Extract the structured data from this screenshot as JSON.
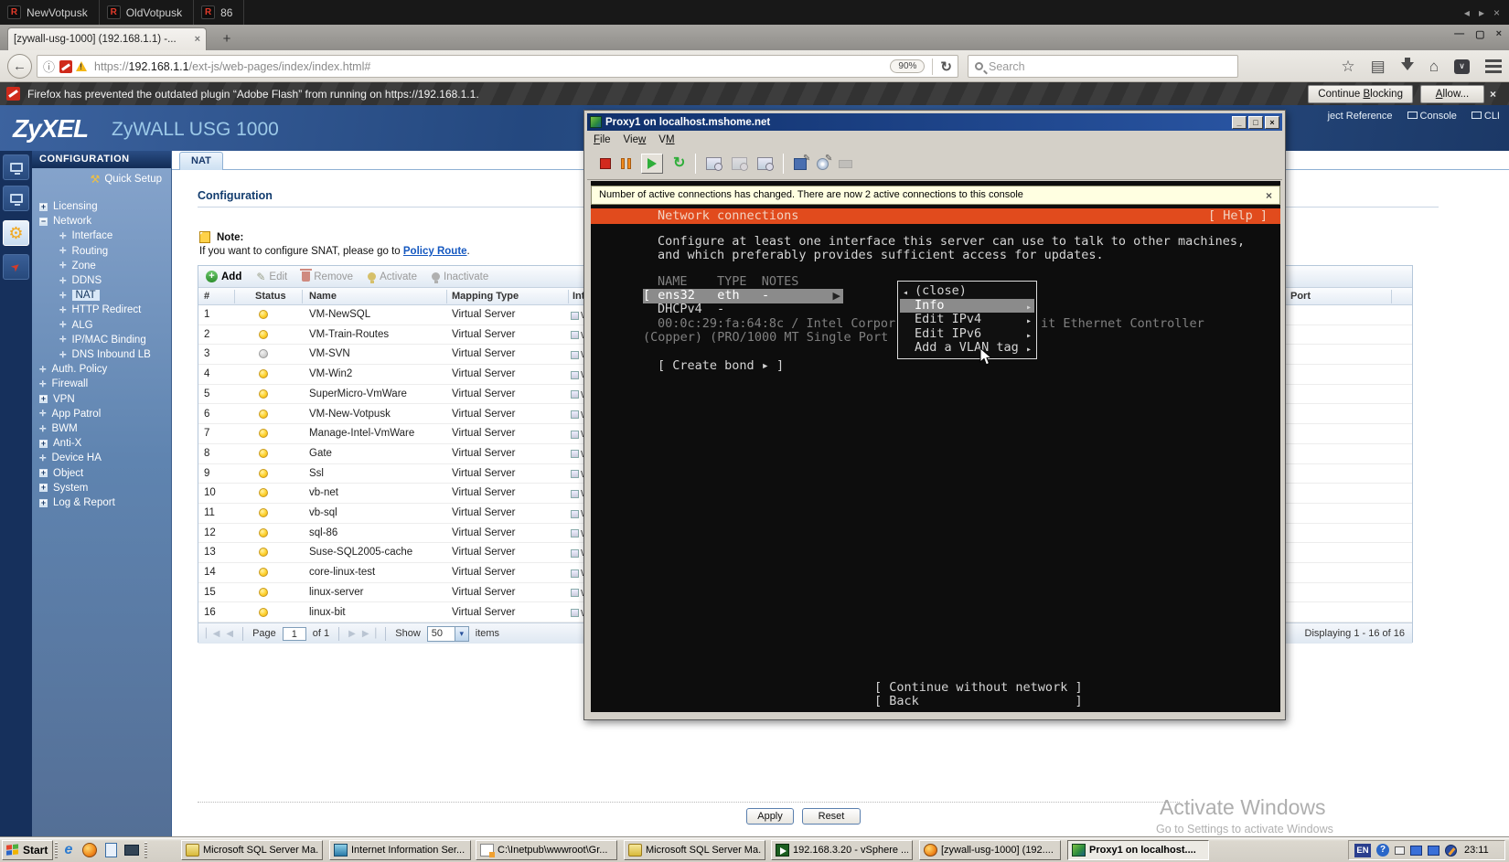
{
  "rdp_bar": {
    "tabs": [
      "NewVotpusk",
      "OldVotpusk",
      "86"
    ],
    "controls": [
      "◂",
      "▸",
      "×"
    ]
  },
  "browser": {
    "tab_title": "[zywall-usg-1000] (192.168.1.1) -...",
    "tab_close": "×",
    "new_tab": "+",
    "back": "←",
    "url_scheme": "https://",
    "url_host": "192.168.1.1",
    "url_path": "/ext-js/web-pages/index/index.html#",
    "zoom_level": "90%",
    "reload": "↻",
    "search_placeholder": "Search",
    "warning_text": "Firefox has prevented the outdated plugin “Adobe Flash” from running on https://192.168.1.1.",
    "btn_continue": "Continue Blocking",
    "btn_allow": "Allow...",
    "warn_close": "×",
    "win_min": "—",
    "win_max": "▢",
    "win_close": "×"
  },
  "zyxel": {
    "brand": "ZyXEL",
    "product": "ZyWALL USG 1000",
    "header_links": [
      "ject Reference",
      "Console",
      "CLI"
    ],
    "sidebar_title": "CONFIGURATION",
    "quick_setup": "Quick Setup",
    "nav": [
      {
        "label": "Licensing",
        "type": "plus",
        "level": 0
      },
      {
        "label": "Network",
        "type": "minus",
        "level": 0
      },
      {
        "label": "Interface",
        "type": "bullet",
        "level": 1
      },
      {
        "label": "Routing",
        "type": "bullet",
        "level": 1
      },
      {
        "label": "Zone",
        "type": "bullet",
        "level": 1
      },
      {
        "label": "DDNS",
        "type": "bullet",
        "level": 1
      },
      {
        "label": "NAT",
        "type": "bullet",
        "level": 1,
        "selected": true
      },
      {
        "label": "HTTP Redirect",
        "type": "bullet",
        "level": 1
      },
      {
        "label": "ALG",
        "type": "bullet",
        "level": 1
      },
      {
        "label": "IP/MAC Binding",
        "type": "bullet",
        "level": 1
      },
      {
        "label": "DNS Inbound LB",
        "type": "bullet",
        "level": 1
      },
      {
        "label": "Auth. Policy",
        "type": "bullet",
        "level": 0
      },
      {
        "label": "Firewall",
        "type": "bullet",
        "level": 0
      },
      {
        "label": "VPN",
        "type": "plus",
        "level": 0
      },
      {
        "label": "App Patrol",
        "type": "bullet",
        "level": 0
      },
      {
        "label": "BWM",
        "type": "bullet",
        "level": 0
      },
      {
        "label": "Anti-X",
        "type": "plus",
        "level": 0
      },
      {
        "label": "Device HA",
        "type": "bullet",
        "level": 0
      },
      {
        "label": "Object",
        "type": "plus",
        "level": 0
      },
      {
        "label": "System",
        "type": "plus",
        "level": 0
      },
      {
        "label": "Log & Report",
        "type": "plus",
        "level": 0
      }
    ],
    "tab": "NAT",
    "section_title": "Configuration",
    "note_label": "Note:",
    "note_text": "If you want to configure SNAT, please go to ",
    "note_link": "Policy Route",
    "note_period": ".",
    "toolbar": [
      {
        "label": "Add",
        "icon": "add",
        "enabled": true
      },
      {
        "label": "Edit",
        "icon": "edit",
        "enabled": false
      },
      {
        "label": "Remove",
        "icon": "remove",
        "enabled": false
      },
      {
        "label": "Activate",
        "icon": "activate",
        "enabled": false
      },
      {
        "label": "Inactivate",
        "icon": "inactivate",
        "enabled": false
      }
    ],
    "table": {
      "columns": [
        "#",
        "Status",
        "Name",
        "Mapping Type",
        "Inter",
        "Port"
      ],
      "interface_fragment": "W",
      "rows": [
        {
          "n": "1",
          "status": "on",
          "name": "VM-NewSQL",
          "mapping": "Virtual Server"
        },
        {
          "n": "2",
          "status": "on",
          "name": "VM-Train-Routes",
          "mapping": "Virtual Server"
        },
        {
          "n": "3",
          "status": "off",
          "name": "VM-SVN",
          "mapping": "Virtual Server"
        },
        {
          "n": "4",
          "status": "on",
          "name": "VM-Win2",
          "mapping": "Virtual Server"
        },
        {
          "n": "5",
          "status": "on",
          "name": "SuperMicro-VmWare",
          "mapping": "Virtual Server"
        },
        {
          "n": "6",
          "status": "on",
          "name": "VM-New-Votpusk",
          "mapping": "Virtual Server"
        },
        {
          "n": "7",
          "status": "on",
          "name": "Manage-Intel-VmWare",
          "mapping": "Virtual Server"
        },
        {
          "n": "8",
          "status": "on",
          "name": "Gate",
          "mapping": "Virtual Server"
        },
        {
          "n": "9",
          "status": "on",
          "name": "Ssl",
          "mapping": "Virtual Server"
        },
        {
          "n": "10",
          "status": "on",
          "name": "vb-net",
          "mapping": "Virtual Server"
        },
        {
          "n": "11",
          "status": "on",
          "name": "vb-sql",
          "mapping": "Virtual Server"
        },
        {
          "n": "12",
          "status": "on",
          "name": "sql-86",
          "mapping": "Virtual Server"
        },
        {
          "n": "13",
          "status": "on",
          "name": "Suse-SQL2005-cache",
          "mapping": "Virtual Server"
        },
        {
          "n": "14",
          "status": "on",
          "name": "core-linux-test",
          "mapping": "Virtual Server"
        },
        {
          "n": "15",
          "status": "on",
          "name": "linux-server",
          "mapping": "Virtual Server"
        },
        {
          "n": "16",
          "status": "on",
          "name": "linux-bit",
          "mapping": "Virtual Server"
        }
      ]
    },
    "pagination": {
      "page_label": "Page",
      "page_value": "1",
      "of_label": "of 1",
      "show_label": "Show",
      "show_value": "50",
      "items_label": "items",
      "displaying": "Displaying 1 - 16 of 16"
    },
    "apply": "Apply",
    "reset": "Reset"
  },
  "vmware": {
    "title": "Proxy1 on localhost.mshome.net",
    "menu": [
      {
        "label": "File",
        "accel": 0
      },
      {
        "label": "View",
        "accel": 3
      },
      {
        "label": "VM",
        "accel": 1
      }
    ],
    "win_min": "_",
    "win_max": "□",
    "win_close": "×",
    "notification": "Number of active connections has changed. There are now 2 active connections to this console",
    "note_close": "×",
    "console": {
      "header": "Network connections",
      "help": "[ Help ]",
      "intro1": "Configure at least one interface this server can use to talk to other machines,",
      "intro2": "and which preferably provides sufficient access for updates.",
      "col_header": "NAME    TYPE  NOTES",
      "row_main": "[ ens32   eth   -",
      "row_arrow": "▶",
      "row_dhcp": "DHCPv4  -",
      "row_mac": "00:0c:29:fa:64:8c / Intel Corpor",
      "row_mac_right": "it Ethernet Controller",
      "row_copper": "(Copper) (PRO/1000 MT Single Port",
      "create_bond": "[ Create bond ▸ ]",
      "menu_items": [
        {
          "label": "(close)",
          "close_mark": "◂"
        },
        {
          "label": "Info",
          "highlight": true,
          "arrow": "▸"
        },
        {
          "label": "Edit IPv4",
          "arrow": "▸"
        },
        {
          "label": "Edit IPv6",
          "arrow": "▸"
        },
        {
          "label": "Add a VLAN tag",
          "arrow": "▸"
        }
      ],
      "continue_btn": "[ Continue without network ]",
      "back_btn": "[ Back                     ]"
    }
  },
  "watermark": {
    "line1": "Activate Windows",
    "line2": "Go to Settings to activate Windows"
  },
  "taskbar": {
    "start_label": "Start",
    "buttons": [
      {
        "label": "Microsoft SQL Server Ma...",
        "icon": "tbi-sql"
      },
      {
        "label": "Internet Information Ser...",
        "icon": "tbi-iis"
      },
      {
        "label": "C:\\Inetpub\\wwwroot\\Gr...",
        "icon": "tbi-doc"
      },
      {
        "label": "Microsoft SQL Server Ma...",
        "icon": "tbi-sql"
      },
      {
        "label": "192.168.3.20 - vSphere ...",
        "icon": "tbi-vs"
      },
      {
        "label": "[zywall-usg-1000] (192....",
        "icon": "tbi-ff"
      },
      {
        "label": "Proxy1 on localhost....",
        "icon": "tbi-vm",
        "active": true
      }
    ],
    "tray": {
      "lang": "EN",
      "help": "?",
      "clock": "23:11"
    }
  }
}
